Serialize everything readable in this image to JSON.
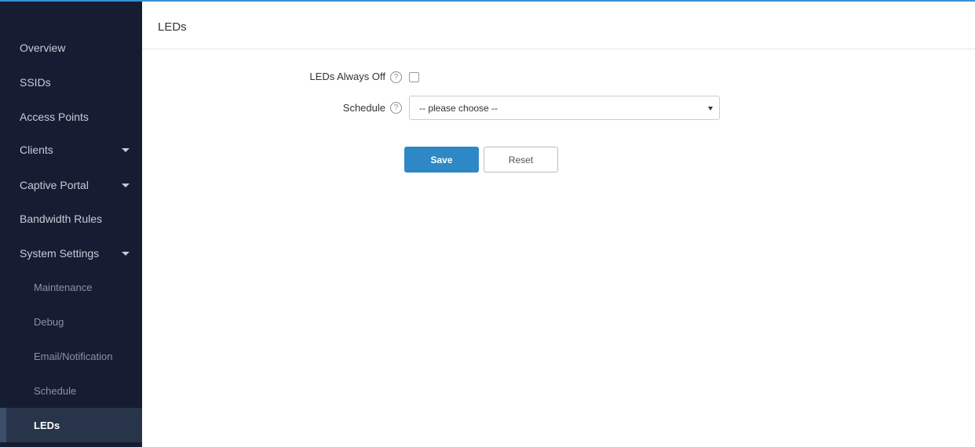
{
  "sidebar": {
    "items": [
      {
        "label": "Overview"
      },
      {
        "label": "SSIDs"
      },
      {
        "label": "Access Points"
      },
      {
        "label": "Clients"
      },
      {
        "label": "Captive Portal"
      },
      {
        "label": "Bandwidth Rules"
      },
      {
        "label": "System Settings"
      }
    ],
    "sub_items": [
      {
        "label": "Maintenance"
      },
      {
        "label": "Debug"
      },
      {
        "label": "Email/Notification"
      },
      {
        "label": "Schedule"
      },
      {
        "label": "LEDs",
        "active": true
      }
    ]
  },
  "page": {
    "title": "LEDs"
  },
  "form": {
    "leds_always_off_label": "LEDs Always Off",
    "leds_always_off_checked": false,
    "schedule_label": "Schedule",
    "schedule_value": "-- please choose --",
    "help_glyph": "?"
  },
  "buttons": {
    "save_label": "Save",
    "reset_label": "Reset"
  },
  "colors": {
    "sidebar_bg": "#161d33",
    "accent": "#2e88c5",
    "active_item_bg": "#27344a"
  }
}
